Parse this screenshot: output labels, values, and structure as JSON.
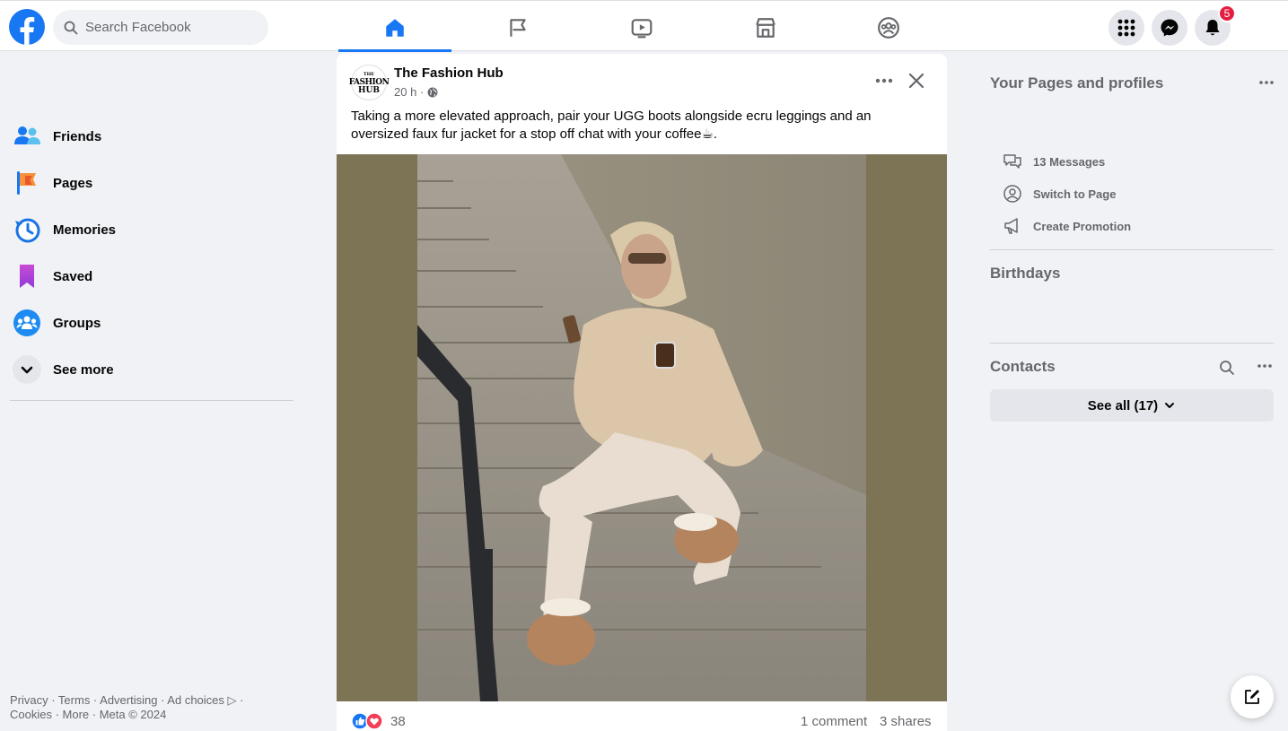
{
  "search": {
    "placeholder": "Search Facebook"
  },
  "notifications": {
    "badge_count": "5"
  },
  "left_nav": {
    "items": [
      {
        "label": "Friends"
      },
      {
        "label": "Pages"
      },
      {
        "label": "Memories"
      },
      {
        "label": "Saved"
      },
      {
        "label": "Groups"
      },
      {
        "label": "See more"
      }
    ],
    "footer_line1": "Privacy · Terms · Advertising · Ad choices ▷ ·",
    "footer_line2": "Cookies · More · Meta © 2024"
  },
  "post": {
    "page_name": "The Fashion Hub",
    "avatar_text": {
      "line1": "THE",
      "line2": "FASHION",
      "line3": "HUB"
    },
    "time": "20 h ·",
    "text": "Taking a more elevated approach, pair your UGG boots alongside ecru leggings and an oversized faux fur jacket for a stop off chat with your coffee☕.",
    "reaction_count": "38",
    "comments": "1 comment",
    "shares": "3 shares"
  },
  "right_sidebar": {
    "pages_title": "Your Pages and profiles",
    "page_actions": [
      {
        "label": "13 Messages",
        "icon": "messages-icon"
      },
      {
        "label": "Switch to Page",
        "icon": "switch-profile-icon"
      },
      {
        "label": "Create Promotion",
        "icon": "megaphone-icon"
      }
    ],
    "birthdays_title": "Birthdays",
    "contacts_title": "Contacts",
    "see_all_label": "See all (17)"
  },
  "colors": {
    "brand": "#1877f2",
    "badge": "#e41e3f",
    "photo_bg": "#7c7455"
  }
}
